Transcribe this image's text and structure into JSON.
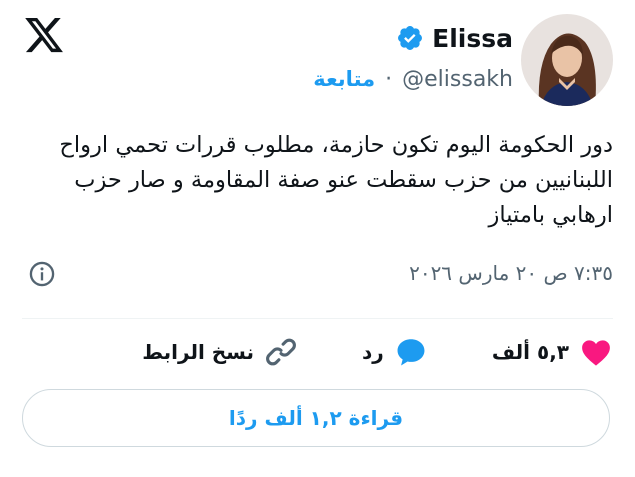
{
  "header": {
    "logo_icon": "x-logo-icon",
    "name": "Elissa",
    "verified_icon": "verified-badge-icon",
    "handle": "@elissakh",
    "separator": "·",
    "follow_label": "متابعة",
    "avatar_icon": "profile-photo"
  },
  "tweet": {
    "text": "دور الحكومة اليوم تكون حازمة، مطلوب قررات تحمي ارواح اللبنانيين من حزب سقطت عنو صفة المقاومة و صار حزب ارهابي بامتياز",
    "timestamp": "٧:٣٥ ص ٢٠ مارس ٢٠٢٦",
    "info_icon": "info-icon"
  },
  "actions": {
    "like_count": "٥,٣ ألف",
    "like_icon": "heart-icon",
    "reply_label": "رد",
    "reply_icon": "reply-bubble-icon",
    "copy_link_label": "نسخ الرابط",
    "copy_link_icon": "link-icon"
  },
  "read_replies_label": "قراءة ١,٢ ألف ردًا",
  "colors": {
    "accent": "#1d9bf0",
    "like": "#f91880",
    "muted": "#536471",
    "text": "#0f1419"
  }
}
